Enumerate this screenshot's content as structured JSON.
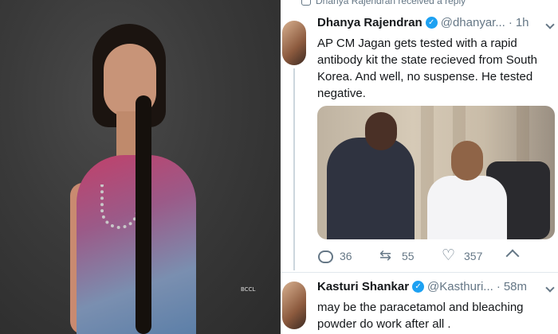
{
  "left_photo": {
    "watermark": "BCCL"
  },
  "reply_notice": {
    "text": "Dhanya Rajendran received a reply"
  },
  "tweet1": {
    "name": "Dhanya Rajendran",
    "handle": "@dhanyar...",
    "separator": "·",
    "time": "1h",
    "text": "AP CM Jagan gets tested with a rapid antibody kit the state recieved from South Korea. And well, no suspense. He tested negative.",
    "actions": {
      "replies": "36",
      "retweets": "55",
      "likes": "357"
    }
  },
  "tweet2": {
    "name": "Kasturi Shankar",
    "handle": "@Kasthuri...",
    "separator": "·",
    "time": "58m",
    "text": "may be the paracetamol and bleaching powder do work  after all ."
  },
  "colors": {
    "verified": "#1da1f2",
    "muted": "#657786",
    "text": "#14171a"
  }
}
